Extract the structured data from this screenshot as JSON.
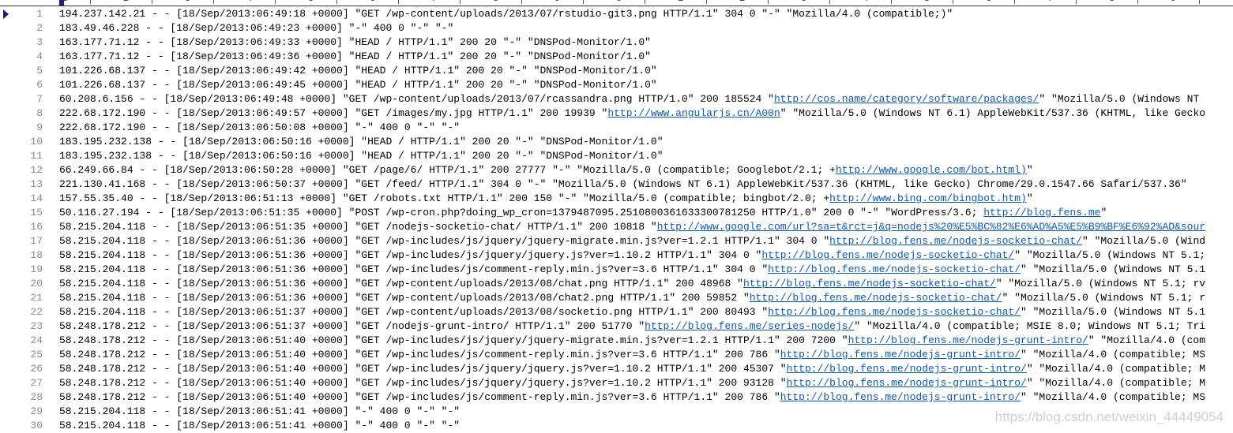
{
  "ruler": {
    "digits": [
      "1",
      "2",
      "3",
      "4",
      "5",
      "6",
      "7",
      "8",
      "9",
      "0",
      "1",
      "2",
      "3",
      "4",
      "5",
      "6",
      "7",
      "8",
      "9",
      "0"
    ]
  },
  "current_line": 1,
  "colors": {
    "link": "#0a58c8",
    "line_number": "#8a8a8a",
    "marker": "#1a1a7a"
  },
  "watermark": "https://blog.csdn.net/weixin_44449054",
  "lines": [
    {
      "n": "1",
      "pre": "194.237.142.21 - - [18/Sep/2013:06:49:18 +0000] \"GET /wp-content/uploads/2013/07/rstudio-git3.png HTTP/1.1\" 304 0 \"-\" \"Mozilla/4.0 (compatible;)\"",
      "link": "",
      "post": ""
    },
    {
      "n": "2",
      "pre": "183.49.46.228 - - [18/Sep/2013:06:49:23 +0000] \"-\" 400 0 \"-\" \"-\"",
      "link": "",
      "post": ""
    },
    {
      "n": "3",
      "pre": "163.177.71.12 - - [18/Sep/2013:06:49:33 +0000] \"HEAD / HTTP/1.1\" 200 20 \"-\" \"DNSPod-Monitor/1.0\"",
      "link": "",
      "post": ""
    },
    {
      "n": "4",
      "pre": "163.177.71.12 - - [18/Sep/2013:06:49:36 +0000] \"HEAD / HTTP/1.1\" 200 20 \"-\" \"DNSPod-Monitor/1.0\"",
      "link": "",
      "post": ""
    },
    {
      "n": "5",
      "pre": "101.226.68.137 - - [18/Sep/2013:06:49:42 +0000] \"HEAD / HTTP/1.1\" 200 20 \"-\" \"DNSPod-Monitor/1.0\"",
      "link": "",
      "post": ""
    },
    {
      "n": "6",
      "pre": "101.226.68.137 - - [18/Sep/2013:06:49:45 +0000] \"HEAD / HTTP/1.1\" 200 20 \"-\" \"DNSPod-Monitor/1.0\"",
      "link": "",
      "post": ""
    },
    {
      "n": "7",
      "pre": "60.208.6.156 - - [18/Sep/2013:06:49:48 +0000] \"GET /wp-content/uploads/2013/07/rcassandra.png HTTP/1.0\" 200 185524 \"",
      "link": "http://cos.name/category/software/packages/",
      "post": "\" \"Mozilla/5.0 (Windows NT"
    },
    {
      "n": "8",
      "pre": "222.68.172.190 - - [18/Sep/2013:06:49:57 +0000] \"GET /images/my.jpg HTTP/1.1\" 200 19939 \"",
      "link": "http://www.angularjs.cn/A00n",
      "post": "\" \"Mozilla/5.0 (Windows NT 6.1) AppleWebKit/537.36 (KHTML, like Gecko"
    },
    {
      "n": "9",
      "pre": "222.68.172.190 - - [18/Sep/2013:06:50:08 +0000] \"-\" 400 0 \"-\" \"-\"",
      "link": "",
      "post": ""
    },
    {
      "n": "10",
      "pre": "183.195.232.138 - - [18/Sep/2013:06:50:16 +0000] \"HEAD / HTTP/1.1\" 200 20 \"-\" \"DNSPod-Monitor/1.0\"",
      "link": "",
      "post": ""
    },
    {
      "n": "11",
      "pre": "183.195.232.138 - - [18/Sep/2013:06:50:16 +0000] \"HEAD / HTTP/1.1\" 200 20 \"-\" \"DNSPod-Monitor/1.0\"",
      "link": "",
      "post": ""
    },
    {
      "n": "12",
      "pre": "66.249.66.84 - - [18/Sep/2013:06:50:28 +0000] \"GET /page/6/ HTTP/1.1\" 200 27777 \"-\" \"Mozilla/5.0 (compatible; Googlebot/2.1; +",
      "link": "http://www.google.com/bot.html)",
      "post": "\""
    },
    {
      "n": "13",
      "pre": "221.130.41.168 - - [18/Sep/2013:06:50:37 +0000] \"GET /feed/ HTTP/1.1\" 304 0 \"-\" \"Mozilla/5.0 (Windows NT 6.1) AppleWebKit/537.36 (KHTML, like Gecko) Chrome/29.0.1547.66 Safari/537.36\"",
      "link": "",
      "post": ""
    },
    {
      "n": "14",
      "pre": "157.55.35.40 - - [18/Sep/2013:06:51:13 +0000] \"GET /robots.txt HTTP/1.1\" 200 150 \"-\" \"Mozilla/5.0 (compatible; bingbot/2.0; +",
      "link": "http://www.bing.com/bingbot.htm)",
      "post": "\""
    },
    {
      "n": "15",
      "pre": "50.116.27.194 - - [18/Sep/2013:06:51:35 +0000] \"POST /wp-cron.php?doing_wp_cron=1379487095.2510800361633300781250 HTTP/1.0\" 200 0 \"-\" \"WordPress/3.6; ",
      "link": "http://blog.fens.me",
      "post": "\""
    },
    {
      "n": "16",
      "pre": "58.215.204.118 - - [18/Sep/2013:06:51:35 +0000] \"GET /nodejs-socketio-chat/ HTTP/1.1\" 200 10818 \"",
      "link": "http://www.google.com/url?sa=t&rct=j&q=nodejs%20%E5%BC%82%E6%AD%A5%E5%B9%BF%E6%92%AD&sour",
      "post": ""
    },
    {
      "n": "17",
      "pre": "58.215.204.118 - - [18/Sep/2013:06:51:36 +0000] \"GET /wp-includes/js/jquery/jquery-migrate.min.js?ver=1.2.1 HTTP/1.1\" 304 0 \"",
      "link": "http://blog.fens.me/nodejs-socketio-chat/",
      "post": "\" \"Mozilla/5.0 (Wind"
    },
    {
      "n": "18",
      "pre": "58.215.204.118 - - [18/Sep/2013:06:51:36 +0000] \"GET /wp-includes/js/jquery/jquery.js?ver=1.10.2 HTTP/1.1\" 304 0 \"",
      "link": "http://blog.fens.me/nodejs-socketio-chat/",
      "post": "\" \"Mozilla/5.0 (Windows NT 5.1;"
    },
    {
      "n": "19",
      "pre": "58.215.204.118 - - [18/Sep/2013:06:51:36 +0000] \"GET /wp-includes/js/comment-reply.min.js?ver=3.6 HTTP/1.1\" 304 0 \"",
      "link": "http://blog.fens.me/nodejs-socketio-chat/",
      "post": "\" \"Mozilla/5.0 (Windows NT 5.1"
    },
    {
      "n": "20",
      "pre": "58.215.204.118 - - [18/Sep/2013:06:51:36 +0000] \"GET /wp-content/uploads/2013/08/chat.png HTTP/1.1\" 200 48968 \"",
      "link": "http://blog.fens.me/nodejs-socketio-chat/",
      "post": "\" \"Mozilla/5.0 (Windows NT 5.1; rv"
    },
    {
      "n": "21",
      "pre": "58.215.204.118 - - [18/Sep/2013:06:51:36 +0000] \"GET /wp-content/uploads/2013/08/chat2.png HTTP/1.1\" 200 59852 \"",
      "link": "http://blog.fens.me/nodejs-socketio-chat/",
      "post": "\" \"Mozilla/5.0 (Windows NT 5.1; r"
    },
    {
      "n": "22",
      "pre": "58.215.204.118 - - [18/Sep/2013:06:51:37 +0000] \"GET /wp-content/uploads/2013/08/socketio.png HTTP/1.1\" 200 80493 \"",
      "link": "http://blog.fens.me/nodejs-socketio-chat/",
      "post": "\" \"Mozilla/5.0 (Windows NT 5.1"
    },
    {
      "n": "23",
      "pre": "58.248.178.212 - - [18/Sep/2013:06:51:37 +0000] \"GET /nodejs-grunt-intro/ HTTP/1.1\" 200 51770 \"",
      "link": "http://blog.fens.me/series-nodejs/",
      "post": "\" \"Mozilla/4.0 (compatible; MSIE 8.0; Windows NT 5.1; Tri"
    },
    {
      "n": "24",
      "pre": "58.248.178.212 - - [18/Sep/2013:06:51:40 +0000] \"GET /wp-includes/js/jquery/jquery-migrate.min.js?ver=1.2.1 HTTP/1.1\" 200 7200 \"",
      "link": "http://blog.fens.me/nodejs-grunt-intro/",
      "post": "\" \"Mozilla/4.0 (com"
    },
    {
      "n": "25",
      "pre": "58.248.178.212 - - [18/Sep/2013:06:51:40 +0000] \"GET /wp-includes/js/comment-reply.min.js?ver=3.6 HTTP/1.1\" 200 786 \"",
      "link": "http://blog.fens.me/nodejs-grunt-intro/",
      "post": "\" \"Mozilla/4.0 (compatible; MS"
    },
    {
      "n": "26",
      "pre": "58.248.178.212 - - [18/Sep/2013:06:51:40 +0000] \"GET /wp-includes/js/jquery/jquery.js?ver=1.10.2 HTTP/1.1\" 200 45307 \"",
      "link": "http://blog.fens.me/nodejs-grunt-intro/",
      "post": "\" \"Mozilla/4.0 (compatible; M"
    },
    {
      "n": "27",
      "pre": "58.248.178.212 - - [18/Sep/2013:06:51:40 +0000] \"GET /wp-includes/js/jquery/jquery.js?ver=1.10.2 HTTP/1.1\" 200 93128 \"",
      "link": "http://blog.fens.me/nodejs-grunt-intro/",
      "post": "\" \"Mozilla/4.0 (compatible; M"
    },
    {
      "n": "28",
      "pre": "58.248.178.212 - - [18/Sep/2013:06:51:40 +0000] \"GET /wp-includes/js/comment-reply.min.js?ver=3.6 HTTP/1.1\" 200 786 \"",
      "link": "http://blog.fens.me/nodejs-grunt-intro/",
      "post": "\" \"Mozilla/4.0 (compatible; MS"
    },
    {
      "n": "29",
      "pre": "58.215.204.118 - - [18/Sep/2013:06:51:41 +0000] \"-\" 400 0 \"-\" \"-\"",
      "link": "",
      "post": ""
    },
    {
      "n": "30",
      "pre": "58.215.204.118 - - [18/Sep/2013:06:51:41 +0000] \"-\" 400 0 \"-\" \"-\"",
      "link": "",
      "post": ""
    }
  ]
}
